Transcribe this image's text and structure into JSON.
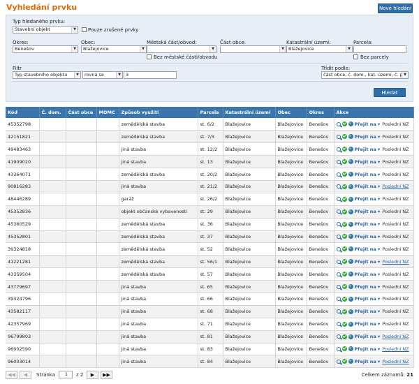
{
  "page": {
    "title": "Vyhledání prvku",
    "new_search_label": "Nové hledání"
  },
  "form": {
    "type_label": "Typ hledaného prvku:",
    "type_value": "Stavební objekt",
    "only_cancelled_label": "Pouze zrušené prvky",
    "okres_label": "Okres:",
    "okres_value": "Benešov",
    "obec_label": "Obec:",
    "obec_value": "Blažejovice",
    "mestska_label": "Městská část/obvod:",
    "mestska_value": "",
    "bez_mestske_label": "Bez městské části/obvodu",
    "cast_obce_label": "Část obce:",
    "cast_obce_value": "",
    "kat_label": "Katastrální území:",
    "kat_value": "Blažejovice",
    "parcela_label": "Parcela:",
    "parcela_value": "",
    "bez_parcely_label": "Bez parcely",
    "filtr_label": "Filtr",
    "filtr_field": "Typ stavebního objektu",
    "filtr_op": "rovná se",
    "filtr_value": "3",
    "sort_label": "Třídit podle:",
    "sort_value": "část obce, č. dom., kat. území, č. pa...",
    "search_button": "Hledat"
  },
  "table": {
    "headers": [
      "Kód",
      "Č. dom.",
      "Část obce",
      "MOMC",
      "Způsob využití",
      "Parcela",
      "Katastrální území",
      "Obec",
      "Okres",
      "Akce"
    ],
    "goto_label": "Přejít na",
    "rows": [
      {
        "kod": "45352798",
        "dom": "",
        "cast": "",
        "momc": "",
        "vyuziti": "zemědělská stavba",
        "parcela": "st. 6/2",
        "ku": "Blažejovice",
        "obec": "Blažejovice",
        "okres": "Benešov",
        "nz": "Poslední NZ",
        "nz_link": false
      },
      {
        "kod": "42151821",
        "dom": "",
        "cast": "",
        "momc": "",
        "vyuziti": "zemědělská stavba",
        "parcela": "st. 7/3",
        "ku": "Blažejovice",
        "obec": "Blažejovice",
        "okres": "Benešov",
        "nz": "Poslední NZ",
        "nz_link": false
      },
      {
        "kod": "49483463",
        "dom": "",
        "cast": "",
        "momc": "",
        "vyuziti": "jiná stavba",
        "parcela": "st. 12/2",
        "ku": "Blažejovice",
        "obec": "Blažejovice",
        "okres": "Benešov",
        "nz": "Poslední NZ",
        "nz_link": false
      },
      {
        "kod": "41909020",
        "dom": "",
        "cast": "",
        "momc": "",
        "vyuziti": "jiná stavba",
        "parcela": "st. 13",
        "ku": "Blažejovice",
        "obec": "Blažejovice",
        "okres": "Benešov",
        "nz": "Poslední NZ",
        "nz_link": false
      },
      {
        "kod": "43364071",
        "dom": "",
        "cast": "",
        "momc": "",
        "vyuziti": "zemědělská stavba",
        "parcela": "st. 20/2",
        "ku": "Blažejovice",
        "obec": "Blažejovice",
        "okres": "Benešov",
        "nz": "Poslední NZ",
        "nz_link": false
      },
      {
        "kod": "90816283",
        "dom": "",
        "cast": "",
        "momc": "",
        "vyuziti": "jiná stavba",
        "parcela": "st. 21/2",
        "ku": "Blažejovice",
        "obec": "Blažejovice",
        "okres": "Benešov",
        "nz": "Poslední NZ",
        "nz_link": true
      },
      {
        "kod": "48446289",
        "dom": "",
        "cast": "",
        "momc": "",
        "vyuziti": "garáž",
        "parcela": "st. 26/2",
        "ku": "Blažejovice",
        "obec": "Blažejovice",
        "okres": "Benešov",
        "nz": "Poslední NZ",
        "nz_link": false
      },
      {
        "kod": "45352836",
        "dom": "",
        "cast": "",
        "momc": "",
        "vyuziti": "objekt občanské vybavenosti",
        "parcela": "st. 29",
        "ku": "Blažejovice",
        "obec": "Blažejovice",
        "okres": "Benešov",
        "nz": "Poslední NZ",
        "nz_link": false
      },
      {
        "kod": "45360529",
        "dom": "",
        "cast": "",
        "momc": "",
        "vyuziti": "zemědělská stavba",
        "parcela": "st. 36",
        "ku": "Blažejovice",
        "obec": "Blažejovice",
        "okres": "Benešov",
        "nz": "Poslední NZ",
        "nz_link": false
      },
      {
        "kod": "45352801",
        "dom": "",
        "cast": "",
        "momc": "",
        "vyuziti": "zemědělská stavba",
        "parcela": "st. 37",
        "ku": "Blažejovice",
        "obec": "Blažejovice",
        "okres": "Benešov",
        "nz": "Poslední NZ",
        "nz_link": false
      },
      {
        "kod": "39324818",
        "dom": "",
        "cast": "",
        "momc": "",
        "vyuziti": "zemědělská stavba",
        "parcela": "st. 52",
        "ku": "Blažejovice",
        "obec": "Blažejovice",
        "okres": "Benešov",
        "nz": "Poslední NZ",
        "nz_link": false
      },
      {
        "kod": "41221281",
        "dom": "",
        "cast": "",
        "momc": "",
        "vyuziti": "zemědělská stavba",
        "parcela": "st. 56/1",
        "ku": "Blažejovice",
        "obec": "Blažejovice",
        "okres": "Benešov",
        "nz": "Poslední NZ",
        "nz_link": true
      },
      {
        "kod": "43359504",
        "dom": "",
        "cast": "",
        "momc": "",
        "vyuziti": "zemědělská stavba",
        "parcela": "st. 57",
        "ku": "Blažejovice",
        "obec": "Blažejovice",
        "okres": "Benešov",
        "nz": "Poslední NZ",
        "nz_link": false
      },
      {
        "kod": "43779697",
        "dom": "",
        "cast": "",
        "momc": "",
        "vyuziti": "jiná stavba",
        "parcela": "st. 65",
        "ku": "Blažejovice",
        "obec": "Blažejovice",
        "okres": "Benešov",
        "nz": "Poslední NZ",
        "nz_link": false
      },
      {
        "kod": "39324796",
        "dom": "",
        "cast": "",
        "momc": "",
        "vyuziti": "jiná stavba",
        "parcela": "st. 66",
        "ku": "Blažejovice",
        "obec": "Blažejovice",
        "okres": "Benešov",
        "nz": "Poslední NZ",
        "nz_link": false
      },
      {
        "kod": "43582117",
        "dom": "",
        "cast": "",
        "momc": "",
        "vyuziti": "jiná stavba",
        "parcela": "st. 68",
        "ku": "Blažejovice",
        "obec": "Blažejovice",
        "okres": "Benešov",
        "nz": "Poslední NZ",
        "nz_link": false
      },
      {
        "kod": "42357969",
        "dom": "",
        "cast": "",
        "momc": "",
        "vyuziti": "jiná stavba",
        "parcela": "st. 71",
        "ku": "Blažejovice",
        "obec": "Blažejovice",
        "okres": "Benešov",
        "nz": "Poslední NZ",
        "nz_link": false
      },
      {
        "kod": "96799803",
        "dom": "",
        "cast": "",
        "momc": "",
        "vyuziti": "jiná stavba",
        "parcela": "st. 81",
        "ku": "Blažejovice",
        "obec": "Blažejovice",
        "okres": "Benešov",
        "nz": "Poslední NZ",
        "nz_link": true
      },
      {
        "kod": "96002590",
        "dom": "",
        "cast": "",
        "momc": "",
        "vyuziti": "jiná stavba",
        "parcela": "st. 83",
        "ku": "Blažejovice",
        "obec": "Blažejovice",
        "okres": "Benešov",
        "nz": "Poslední NZ",
        "nz_link": true
      },
      {
        "kod": "96003014",
        "dom": "",
        "cast": "",
        "momc": "",
        "vyuziti": "jiná stavba",
        "parcela": "st. 84",
        "ku": "Blažejovice",
        "obec": "Blažejovice",
        "okres": "Benešov",
        "nz": "Poslední NZ",
        "nz_link": true
      }
    ]
  },
  "pager": {
    "page_label": "Stránka",
    "page_value": "1",
    "of_label": "z 2",
    "total_label": "Celkem záznamů:",
    "total_value": "21"
  },
  "icons": [
    "first-page-icon",
    "prev-page-icon",
    "next-page-icon",
    "last-page-icon",
    "search-icon",
    "check-icon",
    "globe-icon",
    "caret-down-icon"
  ]
}
